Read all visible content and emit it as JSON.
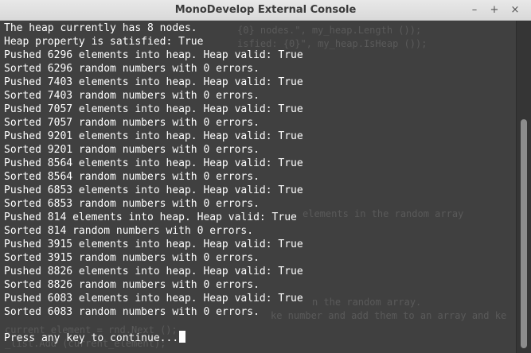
{
  "window": {
    "title": "MonoDevelop External Console",
    "controls": {
      "minimize": "–",
      "maximize": "+",
      "close": "×"
    }
  },
  "console": {
    "lines": [
      "The heap currently has 8 nodes.",
      "Heap property is satisfied: True",
      "Pushed 6296 elements into heap. Heap valid: True",
      "Sorted 6296 random numbers with 0 errors.",
      "Pushed 7403 elements into heap. Heap valid: True",
      "Sorted 7403 random numbers with 0 errors.",
      "Pushed 7057 elements into heap. Heap valid: True",
      "Sorted 7057 random numbers with 0 errors.",
      "Pushed 9201 elements into heap. Heap valid: True",
      "Sorted 9201 random numbers with 0 errors.",
      "Pushed 8564 elements into heap. Heap valid: True",
      "Sorted 8564 random numbers with 0 errors.",
      "Pushed 6853 elements into heap. Heap valid: True",
      "Sorted 6853 random numbers with 0 errors.",
      "Pushed 814 elements into heap. Heap valid: True",
      "Sorted 814 random numbers with 0 errors.",
      "Pushed 3915 elements into heap. Heap valid: True",
      "Sorted 3915 random numbers with 0 errors.",
      "Pushed 8826 elements into heap. Heap valid: True",
      "Sorted 8826 random numbers with 0 errors.",
      "Pushed 6083 elements into heap. Heap valid: True",
      "Sorted 6083 random numbers with 0 errors."
    ],
    "prompt": "Press any key to continue...",
    "background_code": [
      "{0} nodes.\", my_heap.Length ());",
      "isfied: {0}\", my_heap.IsHeap ());",
      "elements in the random array",
      "n the random array.",
      "ke number and add them to an array and ke",
      "current_element = rnd.Next ();",
      "_list.Add (current_element);"
    ]
  },
  "colors": {
    "console_bg": "#404040",
    "text": "#ffffff",
    "titlebar": "#dedede",
    "scroll_thumb": "#8c8c8c"
  }
}
